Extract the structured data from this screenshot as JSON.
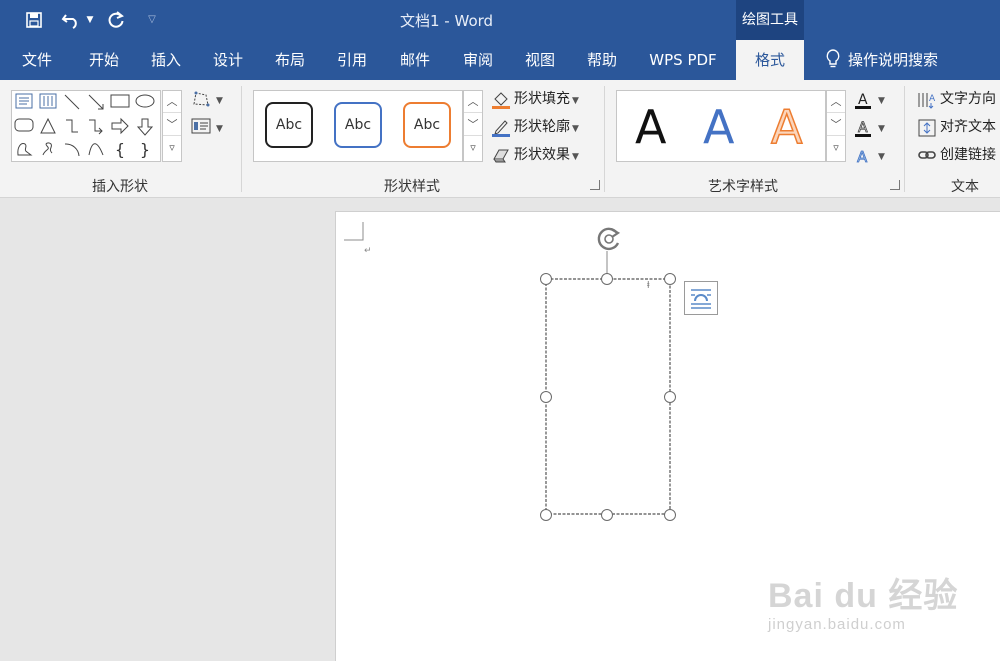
{
  "titlebar": {
    "title": "文档1  -  Word",
    "context_header": "绘图工具",
    "qat": {
      "save_icon": "save-icon",
      "undo_icon": "undo-icon",
      "redo_icon": "redo-icon",
      "customize_icon": "customize-qat-icon"
    }
  },
  "tabs": [
    {
      "label": "文件",
      "active": false
    },
    {
      "label": "开始",
      "active": false
    },
    {
      "label": "插入",
      "active": false
    },
    {
      "label": "设计",
      "active": false
    },
    {
      "label": "布局",
      "active": false
    },
    {
      "label": "引用",
      "active": false
    },
    {
      "label": "邮件",
      "active": false
    },
    {
      "label": "审阅",
      "active": false
    },
    {
      "label": "视图",
      "active": false
    },
    {
      "label": "帮助",
      "active": false
    },
    {
      "label": "WPS PDF",
      "active": false
    },
    {
      "label": "格式",
      "active": true
    }
  ],
  "tell_me": {
    "label": "操作说明搜索",
    "icon": "lightbulb-icon"
  },
  "ribbon": {
    "insert_shapes": {
      "label": "插入形状",
      "shapes": [
        "text-box",
        "vertical-text-box",
        "line",
        "arrow-line",
        "rectangle",
        "oval",
        "rounded-rectangle",
        "triangle",
        "elbow-connector",
        "elbow-arrow-connector",
        "right-arrow",
        "down-arrow",
        "freeform",
        "scribble",
        "arc",
        "curve",
        "{",
        "}"
      ]
    },
    "shape_styles": {
      "label": "形状样式",
      "presets": [
        {
          "text": "Abc",
          "border": "#222222"
        },
        {
          "text": "Abc",
          "border": "#4472c4"
        },
        {
          "text": "Abc",
          "border": "#ed7d31"
        }
      ],
      "fill_label": "形状填充",
      "outline_label": "形状轮廓",
      "effects_label": "形状效果"
    },
    "wordart_styles": {
      "label": "艺术字样式",
      "presets": [
        {
          "text": "A",
          "color": "#111111"
        },
        {
          "text": "A",
          "color": "#4472c4"
        },
        {
          "text": "A",
          "color": "#f4b183"
        }
      ]
    },
    "text": {
      "label": "文本",
      "direction_label": "文字方向",
      "align_label": "对齐文本",
      "link_label": "创建链接"
    }
  },
  "watermark": {
    "main": "Bai  du 经验",
    "sub": "jingyan.baidu.com"
  },
  "colors": {
    "brand": "#2b579a",
    "context": "#1e4480",
    "ribbon_bg": "#f3f3f3",
    "accent_orange": "#ed7d31"
  }
}
